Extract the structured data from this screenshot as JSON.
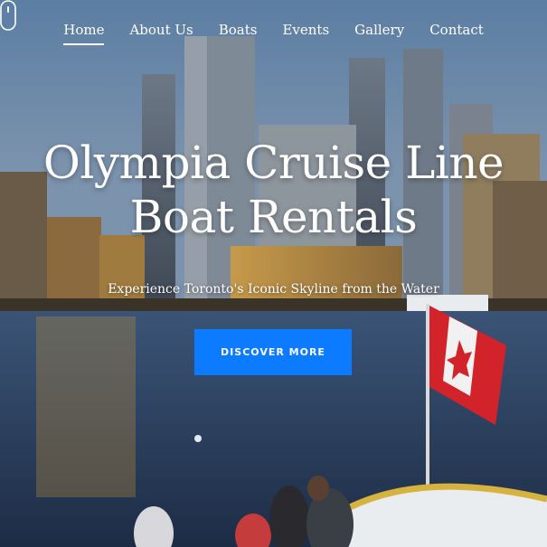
{
  "nav": {
    "items": [
      {
        "label": "Home",
        "active": true
      },
      {
        "label": "About Us",
        "active": false
      },
      {
        "label": "Boats",
        "active": false
      },
      {
        "label": "Events",
        "active": false
      },
      {
        "label": "Gallery",
        "active": false
      },
      {
        "label": "Contact",
        "active": false
      }
    ]
  },
  "hero": {
    "title_line1": "Olympia Cruise Line",
    "title_line2": "Boat Rentals",
    "subtitle": "Experience Toronto's Iconic Skyline from the Water",
    "cta_label": "DISCOVER MORE",
    "slider_dot_icon": "slider-dot",
    "scroll_icon": "mouse-scroll-icon"
  },
  "colors": {
    "accent": "#0d7bff",
    "text": "#ffffff",
    "flag_red": "#d3232a"
  }
}
